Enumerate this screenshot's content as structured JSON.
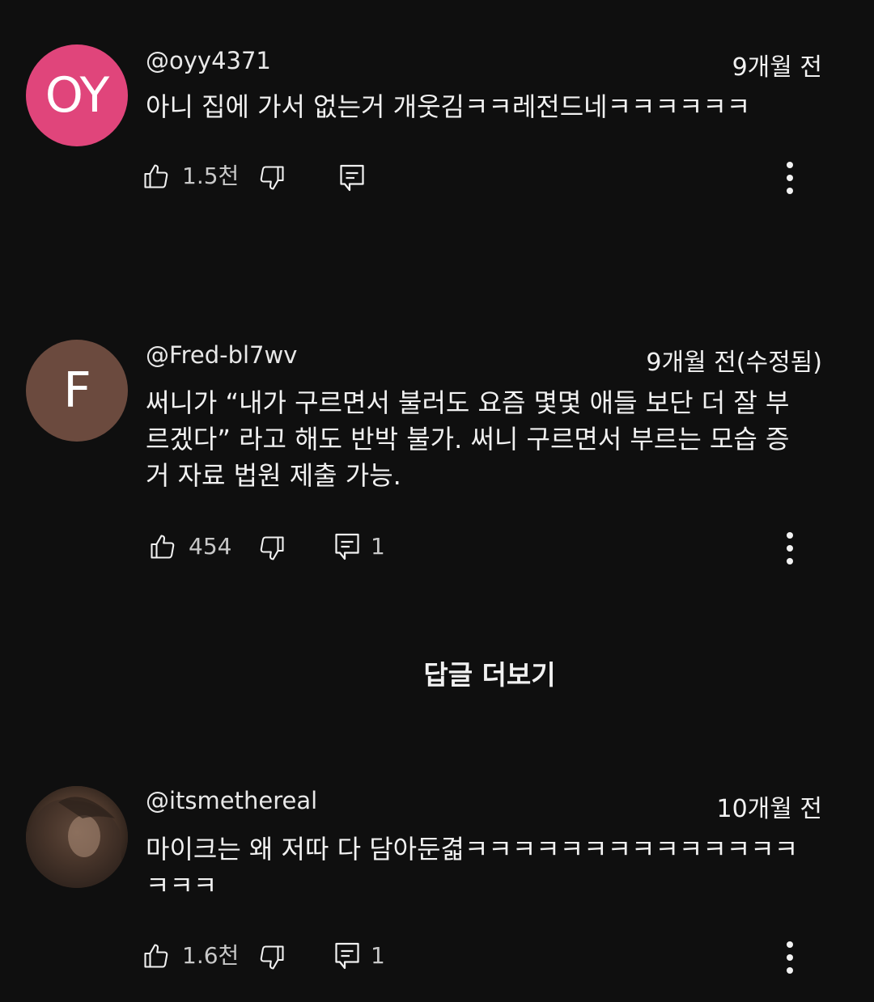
{
  "comments": [
    {
      "avatar_text": "OY",
      "avatar_color": "#e0457b",
      "handle": "@oyy4371",
      "time": "9개월 전",
      "text": "아니 집에 가서 없는거 개웃김ㅋㅋ레전드네ㅋㅋㅋㅋㅋㅋ",
      "likes": "1.5천",
      "replies": ""
    },
    {
      "avatar_text": "F",
      "avatar_color": "#6b4a3e",
      "handle": "@Fred-bl7wv",
      "time": "9개월 전(수정됨)",
      "text_lines": [
        "써니가 “내가 구르면서 불러도 요즘 몇몇 애들 보단 더 잘 부",
        "르겠다” 라고 해도 반박 불가. 써니 구르면서 부르는 모습 증",
        "거 자료 법원 제출 가능."
      ],
      "likes": "454",
      "replies": "1"
    },
    {
      "avatar_text": "",
      "handle": "@itsmethereal",
      "time": "10개월 전",
      "text_lines": [
        "마이크는 왜 저따 다 담아둔겳ㅋㅋㅋㅋㅋㅋㅋㅋㅋㅋㅋㅋㅋㅋ",
        "ㅋㅋㅋ"
      ],
      "likes": "1.6천",
      "replies": "1"
    }
  ],
  "more_replies_label": "답글 더보기",
  "icons": {
    "like": "thumbs-up-icon",
    "dislike": "thumbs-down-icon",
    "reply": "comment-icon",
    "menu": "more-vertical-icon"
  }
}
